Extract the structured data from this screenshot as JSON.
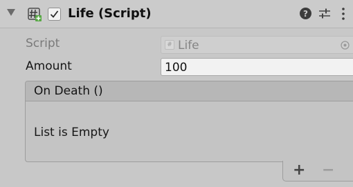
{
  "component": {
    "title": "Life (Script)",
    "enabled": true
  },
  "fields": {
    "script_label": "Script",
    "script_value": "Life",
    "amount_label": "Amount",
    "amount_value": "100"
  },
  "event": {
    "title": "On Death ()",
    "empty_text": "List is Empty",
    "add_label": "+",
    "remove_label": "−"
  },
  "icons": {
    "foldout": "triangle-down-icon",
    "script": "csharp-script-icon",
    "check": "checkmark-icon",
    "help": "help-icon",
    "presets": "presets-icon",
    "menu": "kebab-menu-icon",
    "object_picker": "object-picker-icon",
    "script_field": "script-object-icon"
  }
}
